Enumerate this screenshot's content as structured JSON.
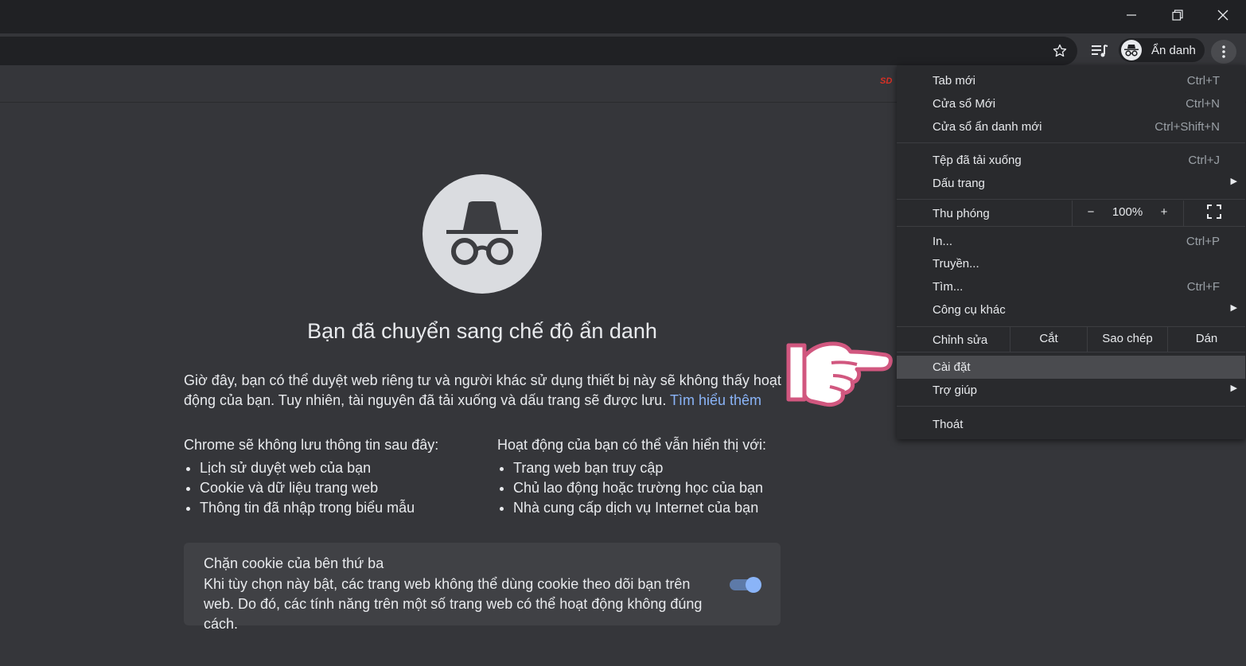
{
  "window": {
    "minimize_icon": "minimize-icon",
    "restore_icon": "restore-icon",
    "close_icon": "close-icon"
  },
  "toolbar": {
    "star_icon": "star-icon",
    "media_icon": "media-control-icon",
    "profile_label": "Ẩn danh",
    "menu_icon": "more-vert-icon"
  },
  "bookmarks_bar": {
    "favicon_text": "SD"
  },
  "page": {
    "heading": "Bạn đã chuyển sang chế độ ẩn danh",
    "intro": "Giờ đây, bạn có thể duyệt web riêng tư và người khác sử dụng thiết bị này sẽ không thấy hoạt động của bạn. Tuy nhiên, tài nguyên đã tải xuống và dấu trang sẽ được lưu.",
    "learn_more": "Tìm hiểu thêm",
    "not_saved_title": "Chrome sẽ không lưu thông tin sau đây:",
    "not_saved_items": [
      "Lịch sử duyệt web của bạn",
      "Cookie và dữ liệu trang web",
      "Thông tin đã nhập trong biểu mẫu"
    ],
    "visible_title": "Hoạt động của bạn có thể vẫn hiển thị với:",
    "visible_items": [
      "Trang web bạn truy cập",
      "Chủ lao động hoặc trường học của bạn",
      "Nhà cung cấp dịch vụ Internet của bạn"
    ],
    "cookie_title": "Chặn cookie của bên thứ ba",
    "cookie_desc": "Khi tùy chọn này bật, các trang web không thể dùng cookie theo dõi bạn trên web. Do đó, các tính năng trên một số trang web có thể hoạt động không đúng cách.",
    "cookie_toggle_on": true
  },
  "menu": {
    "new_tab": {
      "label": "Tab mới",
      "shortcut": "Ctrl+T"
    },
    "new_window": {
      "label": "Cửa sổ Mới",
      "shortcut": "Ctrl+N"
    },
    "new_incognito": {
      "label": "Cửa sổ ẩn danh mới",
      "shortcut": "Ctrl+Shift+N"
    },
    "downloads": {
      "label": "Tệp đã tải xuống",
      "shortcut": "Ctrl+J"
    },
    "bookmarks": {
      "label": "Dấu trang"
    },
    "zoom": {
      "label": "Thu phóng",
      "minus": "−",
      "value": "100%",
      "plus": "+"
    },
    "print": {
      "label": "In...",
      "shortcut": "Ctrl+P"
    },
    "cast": {
      "label": "Truyền..."
    },
    "find": {
      "label": "Tìm...",
      "shortcut": "Ctrl+F"
    },
    "more_tools": {
      "label": "Công cụ khác"
    },
    "edit": {
      "label": "Chỉnh sửa",
      "cut": "Cắt",
      "copy": "Sao chép",
      "paste": "Dán"
    },
    "settings": {
      "label": "Cài đặt"
    },
    "help": {
      "label": "Trợ giúp"
    },
    "exit": {
      "label": "Thoát"
    }
  },
  "colors": {
    "page_bg": "#35363a",
    "menu_bg": "#292a2d",
    "link": "#8ab4f8",
    "highlight": "#4a4b4f",
    "pointer_hand": "#d1577f"
  }
}
